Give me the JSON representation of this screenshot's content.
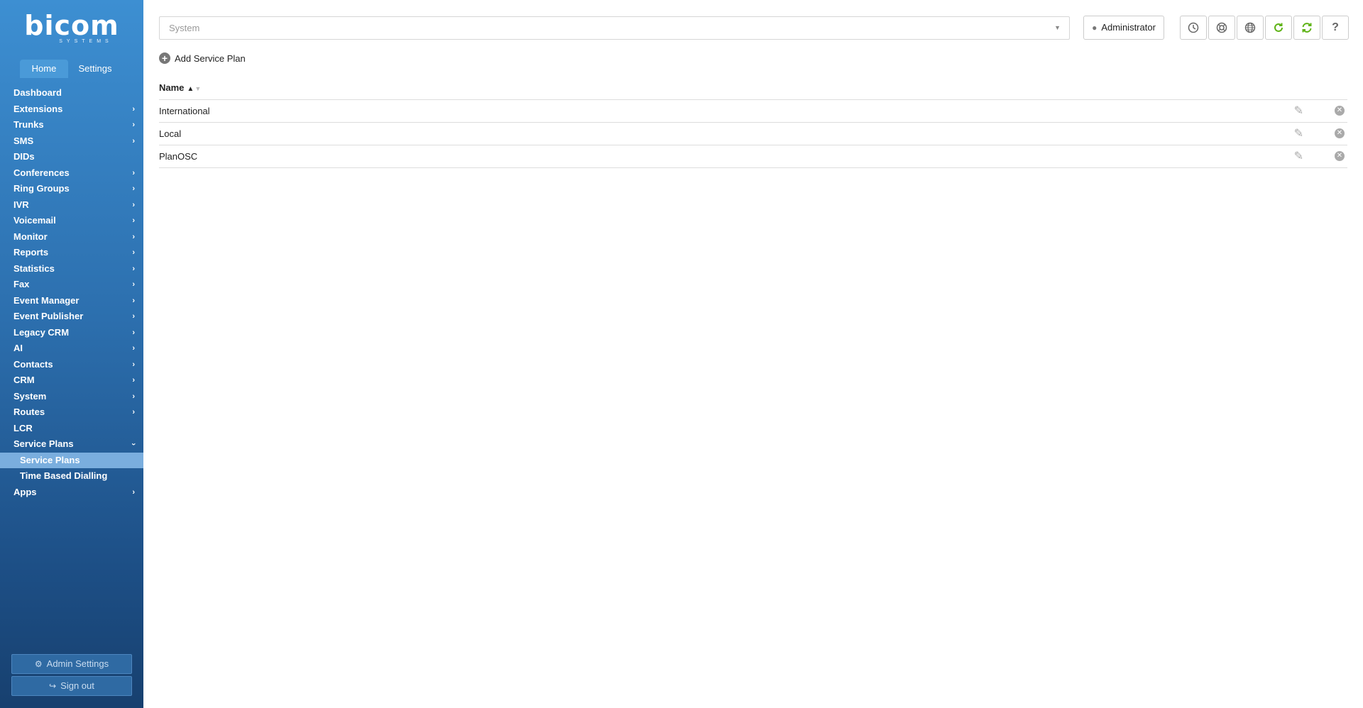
{
  "brand": {
    "logo": "bicom",
    "sub": "SYSTEMS"
  },
  "nav_tabs": [
    {
      "label": "Home",
      "active": true
    },
    {
      "label": "Settings",
      "active": false
    }
  ],
  "menu": {
    "items": [
      {
        "label": "Dashboard"
      },
      {
        "label": "Extensions"
      },
      {
        "label": "Trunks"
      },
      {
        "label": "SMS"
      },
      {
        "label": "DIDs"
      },
      {
        "label": "Conferences"
      },
      {
        "label": "Ring Groups"
      },
      {
        "label": "IVR"
      },
      {
        "label": "Voicemail"
      },
      {
        "label": "Monitor"
      },
      {
        "label": "Reports"
      },
      {
        "label": "Statistics"
      },
      {
        "label": "Fax"
      },
      {
        "label": "Event Manager"
      },
      {
        "label": "Event Publisher"
      },
      {
        "label": "Legacy CRM"
      },
      {
        "label": "AI"
      },
      {
        "label": "Contacts"
      },
      {
        "label": "CRM"
      },
      {
        "label": "System"
      },
      {
        "label": "Routes"
      },
      {
        "label": "LCR"
      },
      {
        "label": "Service Plans"
      },
      {
        "label": "Apps"
      }
    ],
    "sub_items": [
      {
        "label": "Service Plans",
        "active": true
      },
      {
        "label": "Time Based Dialling"
      }
    ]
  },
  "sidebar_buttons": {
    "admin_settings": "Admin Settings",
    "sign_out": "Sign out"
  },
  "header": {
    "system_select": "System",
    "user": "Administrator"
  },
  "toolbar": {
    "icons": [
      "clock-icon",
      "support-icon",
      "globe-icon",
      "reload-icon",
      "sync-icon",
      "help-icon"
    ]
  },
  "actions": {
    "add_label": "Add Service Plan"
  },
  "table": {
    "header_name": "Name",
    "rows": [
      {
        "name": "International"
      },
      {
        "name": "Local"
      },
      {
        "name": "PlanOSC"
      }
    ]
  }
}
